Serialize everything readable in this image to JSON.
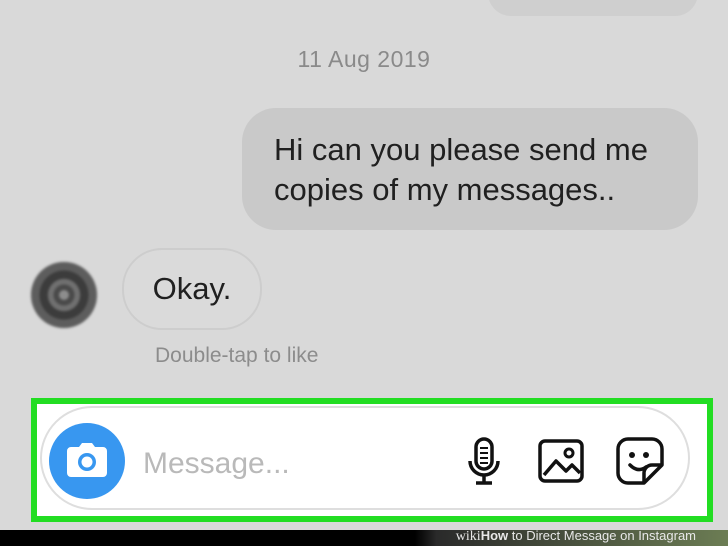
{
  "conversation": {
    "date_label": "11 Aug 2019",
    "outgoing_message": "Hi can you please send me copies of my messages..",
    "incoming_message": "Okay.",
    "like_hint": "Double-tap to like"
  },
  "composer": {
    "placeholder": "Message...",
    "icons": {
      "camera": "camera-icon",
      "mic": "microphone-icon",
      "gallery": "image-gallery-icon",
      "sticker": "sticker-icon"
    }
  },
  "watermark": {
    "wiki": "wiki",
    "how": "How",
    "rest": " to Direct Message on Instagram"
  },
  "colors": {
    "highlight": "#22dd22",
    "camera_button": "#3897f0",
    "background": "#d9d9d9"
  }
}
